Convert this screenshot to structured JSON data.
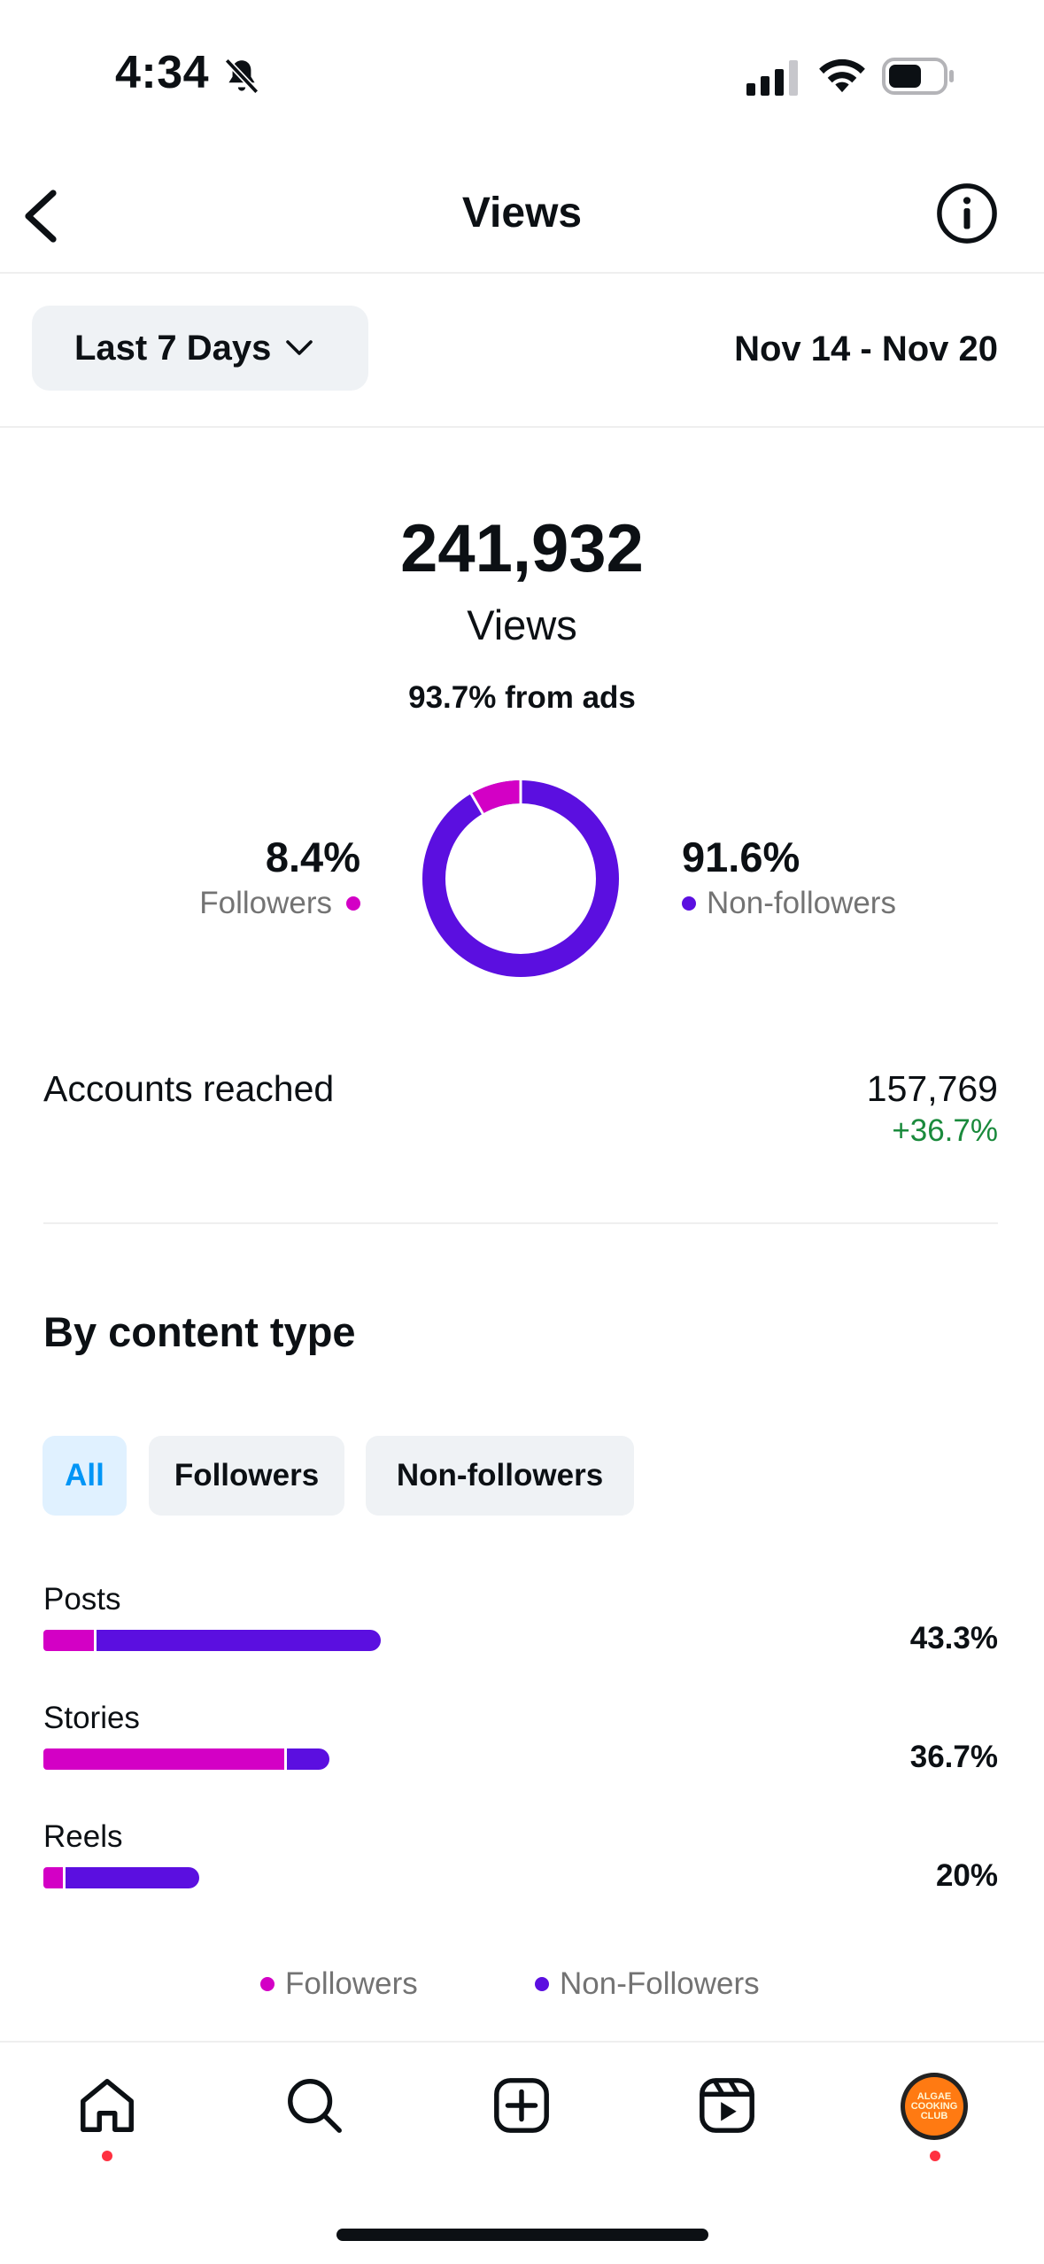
{
  "status_bar": {
    "time": "4:34",
    "icons": [
      "bell-slash-icon",
      "cellular-signal-icon",
      "wifi-icon",
      "battery-icon"
    ]
  },
  "header": {
    "title": "Views",
    "back_icon": "chevron-left-icon",
    "info_icon": "info-circle-icon"
  },
  "range": {
    "selector_label": "Last 7 Days",
    "dates": "Nov 14 - Nov 20"
  },
  "summary": {
    "total": "241,932",
    "label": "Views",
    "ads_note": "93.7% from ads",
    "followers_pct": "8.4%",
    "followers_label": "Followers",
    "nonfollowers_pct": "91.6%",
    "nonfollowers_label": "Non-followers",
    "donut_followers_fraction": 0.084
  },
  "accounts": {
    "label": "Accounts reached",
    "value": "157,769",
    "change": "+36.7%"
  },
  "content_type": {
    "title": "By content type",
    "filters": [
      "All",
      "Followers",
      "Non-followers"
    ],
    "active_filter": "All",
    "rows": [
      {
        "label": "Posts",
        "pct": "43.3%",
        "total_fraction": 0.433,
        "followers_fraction": 0.15
      },
      {
        "label": "Stories",
        "pct": "36.7%",
        "total_fraction": 0.367,
        "followers_fraction": 0.85
      },
      {
        "label": "Reels",
        "pct": "20%",
        "total_fraction": 0.2,
        "followers_fraction": 0.13
      }
    ],
    "legend": [
      "Followers",
      "Non-Followers"
    ]
  },
  "colors": {
    "followers": "#d300c5",
    "nonfollowers": "#5b0fe0",
    "positive": "#1a8a3c",
    "accent": "#0095f6",
    "notification": "#ff3040"
  },
  "bottom_nav": {
    "items": [
      "home-icon",
      "search-icon",
      "create-icon",
      "reels-icon",
      "profile-avatar"
    ],
    "avatar_text": "ALGAE COOKING CLUB"
  }
}
